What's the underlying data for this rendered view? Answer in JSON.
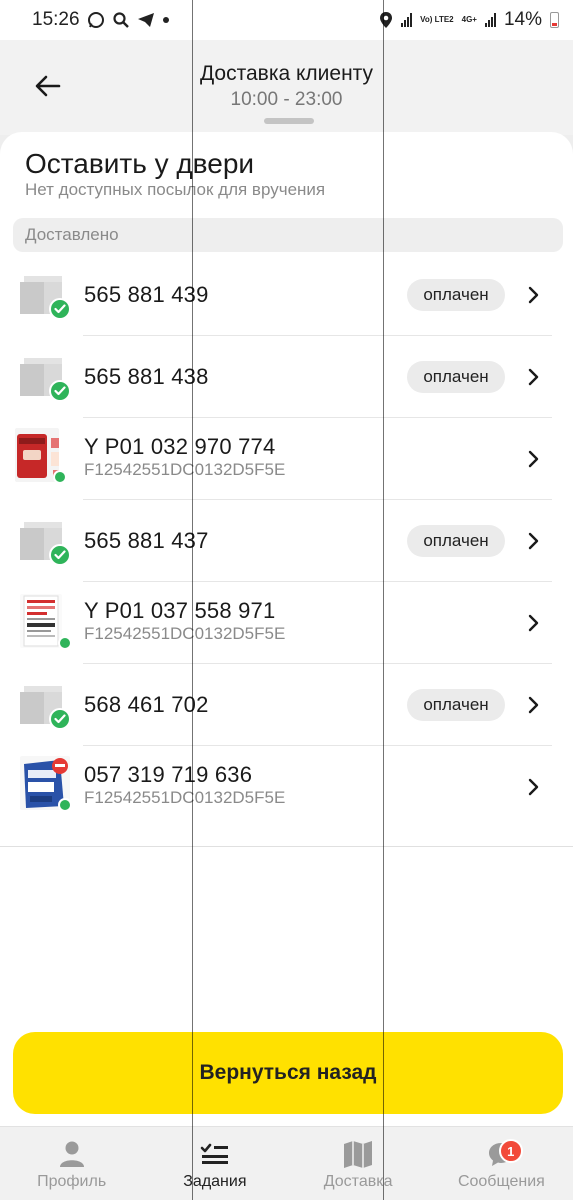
{
  "statusbar": {
    "time": "15:26",
    "left_icons": [
      "whatsapp-icon",
      "search-icon",
      "telegram-icon",
      "dot-icon"
    ],
    "network_1": "Vo) LTE2",
    "network_2": "4G+",
    "battery": "14%"
  },
  "header": {
    "title": "Доставка клиенту",
    "subtitle": "10:00 - 23:00"
  },
  "sheet": {
    "title": "Оставить у двери",
    "subtitle": "Нет доступных посылок для вручения",
    "section": "Доставлено"
  },
  "parcels": [
    {
      "number": "565 881 439",
      "code": "",
      "badge": "оплачен",
      "thumb": "box"
    },
    {
      "number": "565 881 438",
      "code": "",
      "badge": "оплачен",
      "thumb": "box"
    },
    {
      "number": "Y P01 032 970 774",
      "code": "F12542551DC0132D5F5E",
      "badge": "",
      "thumb": "product-red"
    },
    {
      "number": "565 881 437",
      "code": "",
      "badge": "оплачен",
      "thumb": "box"
    },
    {
      "number": "Y P01 037 558 971",
      "code": "F12542551DC0132D5F5E",
      "badge": "",
      "thumb": "product-book"
    },
    {
      "number": "568 461 702",
      "code": "",
      "badge": "оплачен",
      "thumb": "box"
    },
    {
      "number": "057 319 719 636",
      "code": "F12542551DC0132D5F5E",
      "badge": "",
      "thumb": "product-blue"
    }
  ],
  "cta": {
    "label": "Вернуться назад"
  },
  "tabs": [
    {
      "label": "Профиль",
      "icon": "person-icon"
    },
    {
      "label": "Задания",
      "icon": "tasks-icon"
    },
    {
      "label": "Доставка",
      "icon": "map-icon"
    },
    {
      "label": "Сообщения",
      "icon": "chat-icon",
      "badge": "1"
    }
  ],
  "colors": {
    "accent": "#ffe100",
    "success": "#2fb45a",
    "notification": "#f24a3a"
  }
}
